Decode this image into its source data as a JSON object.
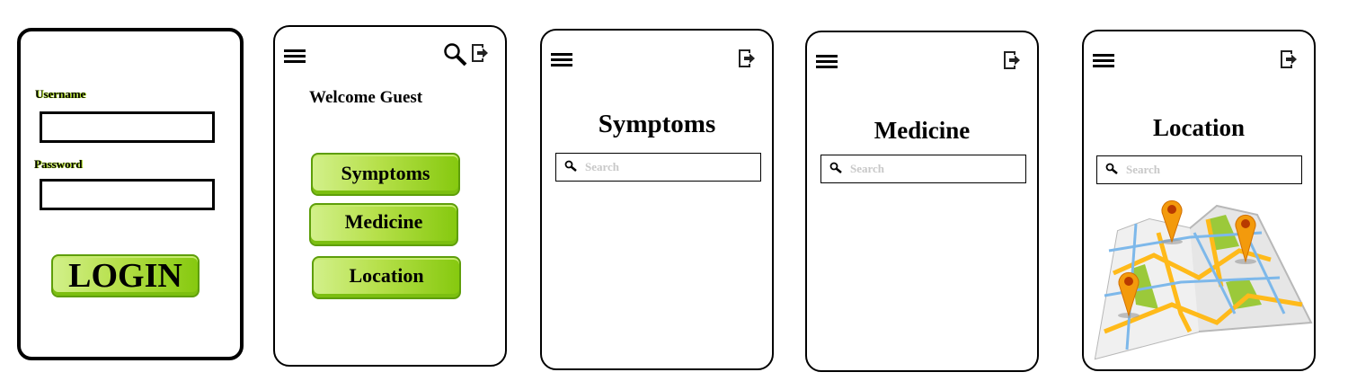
{
  "login": {
    "username_label": "Username",
    "password_label": "Password",
    "username_value": "",
    "password_value": "",
    "login_button": "LOGIN"
  },
  "home": {
    "welcome": "Welcome Guest",
    "buttons": [
      "Symptoms",
      "Medicine",
      "Location"
    ]
  },
  "symptoms": {
    "title": "Symptoms",
    "search_placeholder": "Search"
  },
  "medicine": {
    "title": "Medicine",
    "search_placeholder": "Search"
  },
  "location": {
    "title": "Location",
    "search_placeholder": "Search"
  },
  "icons": {
    "menu": "hamburger-menu-icon",
    "logout": "logout-icon",
    "search": "magnifier-icon",
    "map": "map-pins-illustration"
  },
  "colors": {
    "button_green": "#9ad62a",
    "label_highlight": "#9acd00",
    "placeholder": "#c8c8c8"
  }
}
